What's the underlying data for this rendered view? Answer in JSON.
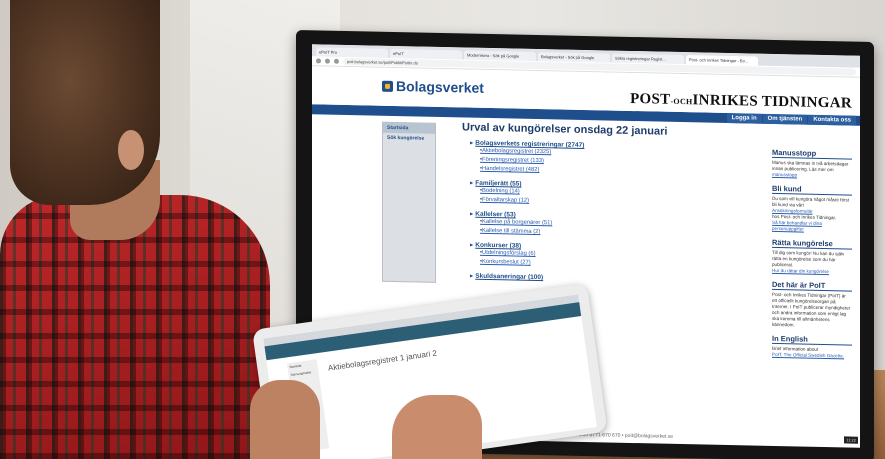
{
  "browser": {
    "tabs": [
      {
        "label": "ePoIT Pro"
      },
      {
        "label": "ePoIT"
      },
      {
        "label": "Modernisera - Sök på Google"
      },
      {
        "label": "Bolagsverket - Sök på Google"
      },
      {
        "label": "Sökta registreringar Regist..."
      },
      {
        "label": "Post- och Inrikes Tidningar - Bo..."
      }
    ],
    "url": "poit.bolagsverket.se/poit/PublikPoitIn.do"
  },
  "site": {
    "logo": "Bolagsverket",
    "masthead_prefix": "POST",
    "masthead_och": "-OCH",
    "masthead_rest": "INRIKES TIDNINGAR",
    "nav": [
      "Logga in",
      "Om tjänsten",
      "Kontakta oss"
    ],
    "left_nav": [
      "Startsida",
      "Sök kungörelse"
    ],
    "heading": "Urval av kungörelser onsdag 22 januari",
    "categories": [
      {
        "title": "Bolagsverkets registreringar (2747)",
        "subs": [
          "Aktiebolagsregistret (2325)",
          "Föreningsregistret (133)",
          "Handelsregistret (482)"
        ]
      },
      {
        "title": "Familjerätt (55)",
        "subs": [
          "Bodelning (14)",
          "Förvaltarskap (12)"
        ]
      },
      {
        "title": "Kallelser (53)",
        "subs": [
          "Kallelse på borgenärer (51)",
          "Kallelse till stämma (2)"
        ]
      },
      {
        "title": "Konkurser (38)",
        "subs": [
          "Utdelningsförslag (6)",
          "Konkursbeslut (27)"
        ]
      },
      {
        "title": "Skuldsaneringar (100)",
        "subs": []
      }
    ],
    "sidebar": {
      "manusstopp_title": "Manusstopp",
      "manusstopp_text": "Manus ska lämnas in två arbetsdagar innan publicering. Läs mer om",
      "manusstopp_link": "manusstopp",
      "bli_kund_title": "Bli kund",
      "bli_kund_text": "Du som vill kungöra något måste först bli kund via vårt",
      "bli_kund_link1": "Ansökningsformulär",
      "bli_kund_text2": "hos Post- och Inrikes Tidningar.",
      "bli_kund_link2": "Så här behandlar vi dina personuppgifter",
      "ratta_title": "Rätta kungörelse",
      "ratta_text": "Till dig som kungör! Nu kan du själv rätta en kungörelse som du har publicerat.",
      "ratta_link": "Hur du rättar din kungörelse",
      "det_har_title": "Det här är PoIT",
      "det_har_text": "Post- och Inrikes Tidningar (PoIT) är ett officiellt kungörelseorgan på Internet. I PoIT publicerar myndigheter och andra information som enligt lag ska komma till allmänhetens kännedom.",
      "english_title": "In English",
      "english_text": "Brief information about",
      "english_link": "PoIT, The Official Swedish Gazette."
    },
    "footer": "Telefon 0771-670 670 • poit@bolagsverket.se",
    "clock": "11:22"
  },
  "tablet": {
    "heading": "Aktiebolagsregistret 1 januari 2"
  }
}
